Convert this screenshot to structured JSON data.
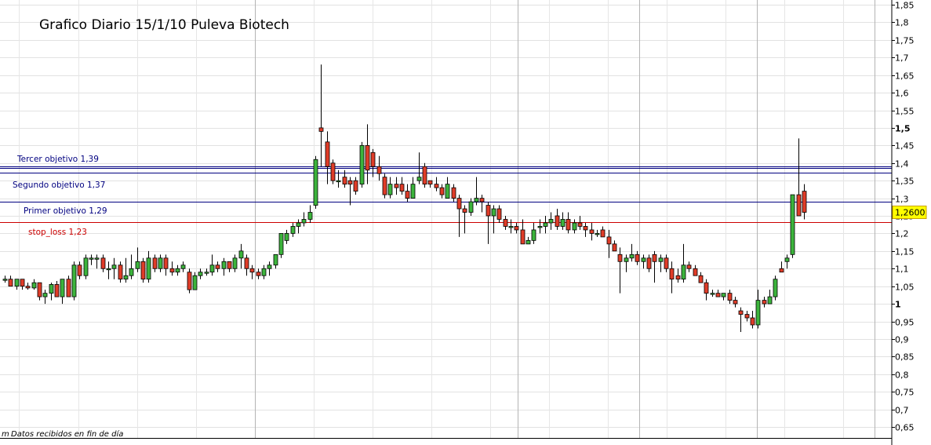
{
  "chart_data": {
    "type": "candlestick",
    "title": "Grafico Diario 15/1/10  Puleva Biotech",
    "footer": "Datos recibidos en fin de día",
    "footer_prefix": "m",
    "ylim": [
      0.625,
      1.86
    ],
    "ytick_labels": [
      "1,85",
      "1,8",
      "1,75",
      "1,7",
      "1,65",
      "1,6",
      "1,55",
      "1,5",
      "1,45",
      "1,4",
      "1,35",
      "1,3",
      "1,25",
      "1,2",
      "1,15",
      "1,1",
      "1,05",
      "1",
      "0,95",
      "0,9",
      "0,85",
      "0,8",
      "0,75",
      "0,7",
      "0,65"
    ],
    "ytick_values": [
      1.85,
      1.8,
      1.75,
      1.7,
      1.65,
      1.6,
      1.55,
      1.5,
      1.45,
      1.4,
      1.35,
      1.3,
      1.25,
      1.2,
      1.15,
      1.1,
      1.05,
      1.0,
      0.95,
      0.9,
      0.85,
      0.8,
      0.75,
      0.7,
      0.65
    ],
    "bold_ticks": [
      "1,5",
      "1"
    ],
    "last_price": "1,2600",
    "last_price_value": 1.26,
    "levels": [
      {
        "label": "Tercer objetivo 1,39",
        "value": 1.39,
        "color": "#000080"
      },
      {
        "label": "",
        "value": 1.375,
        "color": "#000080"
      },
      {
        "label": "Segundo objetivo 1,37",
        "value": 1.37,
        "color": "#000080"
      },
      {
        "label": "Primer objetivo 1,29",
        "value": 1.29,
        "color": "#000080"
      },
      {
        "label": "stop_loss  1,23",
        "value": 1.23,
        "color": "#cc0000"
      }
    ],
    "grid": true,
    "up_color": "#3cb43c",
    "down_color": "#e03c28",
    "candles": [
      [
        1.07,
        1.08,
        1.06,
        1.07
      ],
      [
        1.07,
        1.08,
        1.05,
        1.05
      ],
      [
        1.05,
        1.07,
        1.04,
        1.07
      ],
      [
        1.07,
        1.07,
        1.04,
        1.05
      ],
      [
        1.05,
        1.06,
        1.04,
        1.045
      ],
      [
        1.045,
        1.07,
        1.04,
        1.06
      ],
      [
        1.06,
        1.06,
        1.01,
        1.02
      ],
      [
        1.02,
        1.04,
        1.0,
        1.03
      ],
      [
        1.03,
        1.06,
        1.01,
        1.055
      ],
      [
        1.055,
        1.065,
        1.02,
        1.02
      ],
      [
        1.02,
        1.06,
        1.0,
        1.07
      ],
      [
        1.07,
        1.08,
        1.02,
        1.02
      ],
      [
        1.02,
        1.12,
        1.01,
        1.11
      ],
      [
        1.11,
        1.12,
        1.07,
        1.08
      ],
      [
        1.08,
        1.14,
        1.07,
        1.13
      ],
      [
        1.13,
        1.14,
        1.11,
        1.13
      ],
      [
        1.13,
        1.14,
        1.1,
        1.13
      ],
      [
        1.13,
        1.14,
        1.09,
        1.1
      ],
      [
        1.1,
        1.12,
        1.07,
        1.1
      ],
      [
        1.1,
        1.13,
        1.07,
        1.11
      ],
      [
        1.11,
        1.12,
        1.06,
        1.07
      ],
      [
        1.07,
        1.13,
        1.06,
        1.08
      ],
      [
        1.08,
        1.14,
        1.07,
        1.1
      ],
      [
        1.1,
        1.16,
        1.09,
        1.12
      ],
      [
        1.12,
        1.13,
        1.06,
        1.07
      ],
      [
        1.07,
        1.15,
        1.06,
        1.13
      ],
      [
        1.13,
        1.14,
        1.09,
        1.1
      ],
      [
        1.1,
        1.14,
        1.09,
        1.13
      ],
      [
        1.13,
        1.14,
        1.08,
        1.1
      ],
      [
        1.1,
        1.12,
        1.08,
        1.09
      ],
      [
        1.09,
        1.11,
        1.08,
        1.1
      ],
      [
        1.1,
        1.12,
        1.09,
        1.11
      ],
      [
        1.09,
        1.1,
        1.03,
        1.04
      ],
      [
        1.04,
        1.09,
        1.04,
        1.08
      ],
      [
        1.08,
        1.1,
        1.07,
        1.09
      ],
      [
        1.09,
        1.1,
        1.08,
        1.09
      ],
      [
        1.09,
        1.14,
        1.08,
        1.11
      ],
      [
        1.11,
        1.12,
        1.09,
        1.1
      ],
      [
        1.1,
        1.13,
        1.08,
        1.12
      ],
      [
        1.12,
        1.12,
        1.09,
        1.1
      ],
      [
        1.1,
        1.14,
        1.09,
        1.13
      ],
      [
        1.13,
        1.17,
        1.1,
        1.15
      ],
      [
        1.13,
        1.14,
        1.08,
        1.1
      ],
      [
        1.1,
        1.11,
        1.07,
        1.09
      ],
      [
        1.09,
        1.1,
        1.07,
        1.08
      ],
      [
        1.08,
        1.11,
        1.07,
        1.1
      ],
      [
        1.1,
        1.12,
        1.08,
        1.11
      ],
      [
        1.11,
        1.14,
        1.1,
        1.14
      ],
      [
        1.14,
        1.18,
        1.13,
        1.2
      ],
      [
        1.18,
        1.21,
        1.17,
        1.2
      ],
      [
        1.2,
        1.23,
        1.19,
        1.22
      ],
      [
        1.22,
        1.24,
        1.2,
        1.23
      ],
      [
        1.23,
        1.26,
        1.22,
        1.24
      ],
      [
        1.24,
        1.28,
        1.23,
        1.26
      ],
      [
        1.28,
        1.42,
        1.27,
        1.41
      ],
      [
        1.5,
        1.68,
        1.39,
        1.49
      ],
      [
        1.46,
        1.49,
        1.34,
        1.39
      ],
      [
        1.4,
        1.41,
        1.34,
        1.35
      ],
      [
        1.35,
        1.38,
        1.33,
        1.35
      ],
      [
        1.36,
        1.38,
        1.33,
        1.34
      ],
      [
        1.35,
        1.36,
        1.28,
        1.34
      ],
      [
        1.35,
        1.36,
        1.31,
        1.32
      ],
      [
        1.34,
        1.46,
        1.33,
        1.45
      ],
      [
        1.45,
        1.51,
        1.34,
        1.38
      ],
      [
        1.43,
        1.44,
        1.36,
        1.39
      ],
      [
        1.39,
        1.42,
        1.35,
        1.37
      ],
      [
        1.36,
        1.37,
        1.3,
        1.31
      ],
      [
        1.31,
        1.36,
        1.3,
        1.34
      ],
      [
        1.34,
        1.36,
        1.31,
        1.33
      ],
      [
        1.34,
        1.36,
        1.31,
        1.32
      ],
      [
        1.32,
        1.34,
        1.29,
        1.3
      ],
      [
        1.3,
        1.36,
        1.3,
        1.34
      ],
      [
        1.35,
        1.43,
        1.34,
        1.36
      ],
      [
        1.39,
        1.4,
        1.33,
        1.34
      ],
      [
        1.35,
        1.35,
        1.33,
        1.34
      ],
      [
        1.34,
        1.36,
        1.32,
        1.33
      ],
      [
        1.33,
        1.34,
        1.3,
        1.31
      ],
      [
        1.3,
        1.36,
        1.3,
        1.34
      ],
      [
        1.33,
        1.34,
        1.29,
        1.3
      ],
      [
        1.3,
        1.31,
        1.19,
        1.27
      ],
      [
        1.27,
        1.28,
        1.2,
        1.26
      ],
      [
        1.26,
        1.3,
        1.25,
        1.29
      ],
      [
        1.29,
        1.36,
        1.28,
        1.3
      ],
      [
        1.3,
        1.31,
        1.26,
        1.29
      ],
      [
        1.28,
        1.29,
        1.17,
        1.25
      ],
      [
        1.25,
        1.28,
        1.2,
        1.27
      ],
      [
        1.27,
        1.28,
        1.23,
        1.24
      ],
      [
        1.24,
        1.25,
        1.21,
        1.22
      ],
      [
        1.22,
        1.24,
        1.2,
        1.22
      ],
      [
        1.22,
        1.23,
        1.2,
        1.21
      ],
      [
        1.21,
        1.24,
        1.18,
        1.17
      ],
      [
        1.17,
        1.19,
        1.17,
        1.18
      ],
      [
        1.18,
        1.23,
        1.17,
        1.21
      ],
      [
        1.22,
        1.24,
        1.2,
        1.22
      ],
      [
        1.22,
        1.25,
        1.2,
        1.23
      ],
      [
        1.23,
        1.26,
        1.21,
        1.24
      ],
      [
        1.25,
        1.27,
        1.21,
        1.22
      ],
      [
        1.22,
        1.26,
        1.21,
        1.24
      ],
      [
        1.24,
        1.26,
        1.2,
        1.21
      ],
      [
        1.21,
        1.24,
        1.2,
        1.23
      ],
      [
        1.23,
        1.25,
        1.21,
        1.22
      ],
      [
        1.22,
        1.23,
        1.19,
        1.21
      ],
      [
        1.21,
        1.23,
        1.18,
        1.2
      ],
      [
        1.2,
        1.21,
        1.19,
        1.2
      ],
      [
        1.21,
        1.22,
        1.19,
        1.19
      ],
      [
        1.19,
        1.21,
        1.13,
        1.17
      ],
      [
        1.17,
        1.18,
        1.15,
        1.15
      ],
      [
        1.14,
        1.16,
        1.03,
        1.12
      ],
      [
        1.12,
        1.14,
        1.09,
        1.13
      ],
      [
        1.13,
        1.17,
        1.12,
        1.14
      ],
      [
        1.14,
        1.15,
        1.11,
        1.12
      ],
      [
        1.12,
        1.14,
        1.1,
        1.13
      ],
      [
        1.13,
        1.14,
        1.09,
        1.1
      ],
      [
        1.14,
        1.15,
        1.06,
        1.12
      ],
      [
        1.12,
        1.14,
        1.09,
        1.13
      ],
      [
        1.13,
        1.14,
        1.09,
        1.1
      ],
      [
        1.1,
        1.12,
        1.03,
        1.07
      ],
      [
        1.08,
        1.1,
        1.06,
        1.07
      ],
      [
        1.07,
        1.17,
        1.06,
        1.11
      ],
      [
        1.11,
        1.12,
        1.09,
        1.1
      ],
      [
        1.1,
        1.11,
        1.08,
        1.08
      ],
      [
        1.08,
        1.09,
        1.07,
        1.06
      ],
      [
        1.06,
        1.07,
        1.01,
        1.03
      ],
      [
        1.03,
        1.04,
        1.02,
        1.03
      ],
      [
        1.03,
        1.04,
        1.02,
        1.02
      ],
      [
        1.02,
        1.03,
        1.01,
        1.03
      ],
      [
        1.03,
        1.04,
        1.0,
        1.01
      ],
      [
        1.01,
        1.02,
        0.99,
        1.0
      ],
      [
        0.98,
        0.99,
        0.92,
        0.97
      ],
      [
        0.97,
        0.98,
        0.95,
        0.96
      ],
      [
        0.96,
        0.98,
        0.93,
        0.94
      ],
      [
        0.94,
        1.04,
        0.93,
        1.01
      ],
      [
        1.01,
        1.02,
        0.99,
        1.0
      ],
      [
        1.0,
        1.04,
        1.0,
        1.02
      ],
      [
        1.02,
        1.08,
        1.01,
        1.07
      ],
      [
        1.1,
        1.12,
        1.09,
        1.09
      ],
      [
        1.12,
        1.14,
        1.1,
        1.13
      ],
      [
        1.14,
        1.31,
        1.13,
        1.31
      ],
      [
        1.31,
        1.47,
        1.25,
        1.25
      ],
      [
        1.32,
        1.34,
        1.24,
        1.26
      ]
    ]
  }
}
